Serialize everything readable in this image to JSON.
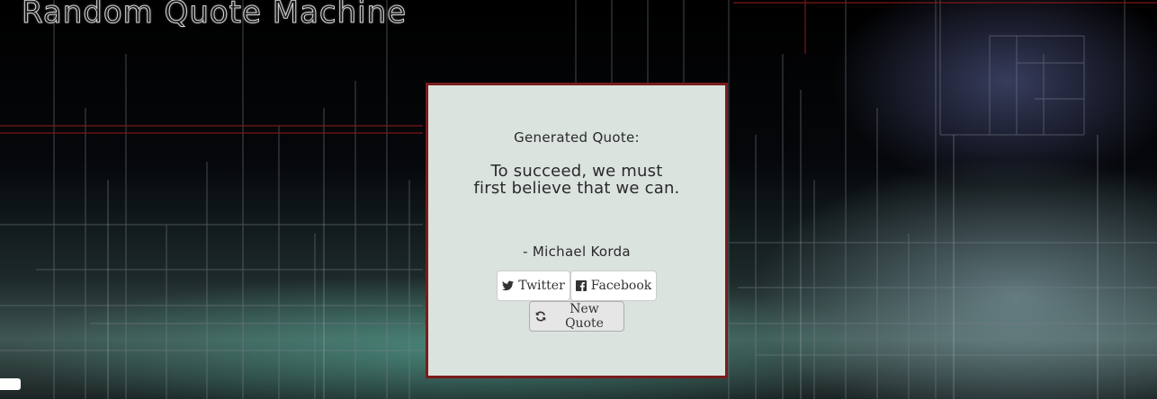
{
  "app": {
    "title": "Random Quote Machine"
  },
  "quote": {
    "label": "Generated Quote:",
    "text": "To succeed, we must first believe that we can.",
    "author": "- Michael Korda"
  },
  "buttons": {
    "twitter": {
      "label": "Twitter",
      "icon": "twitter-icon"
    },
    "facebook": {
      "label": "Facebook",
      "icon": "facebook-icon"
    },
    "new_quote": {
      "label": "New Quote",
      "icon": "refresh-icon"
    }
  },
  "colors": {
    "box_background": "#dbe3df",
    "box_border": "#7a1c1c",
    "accent_line": "#8b1a1a"
  }
}
